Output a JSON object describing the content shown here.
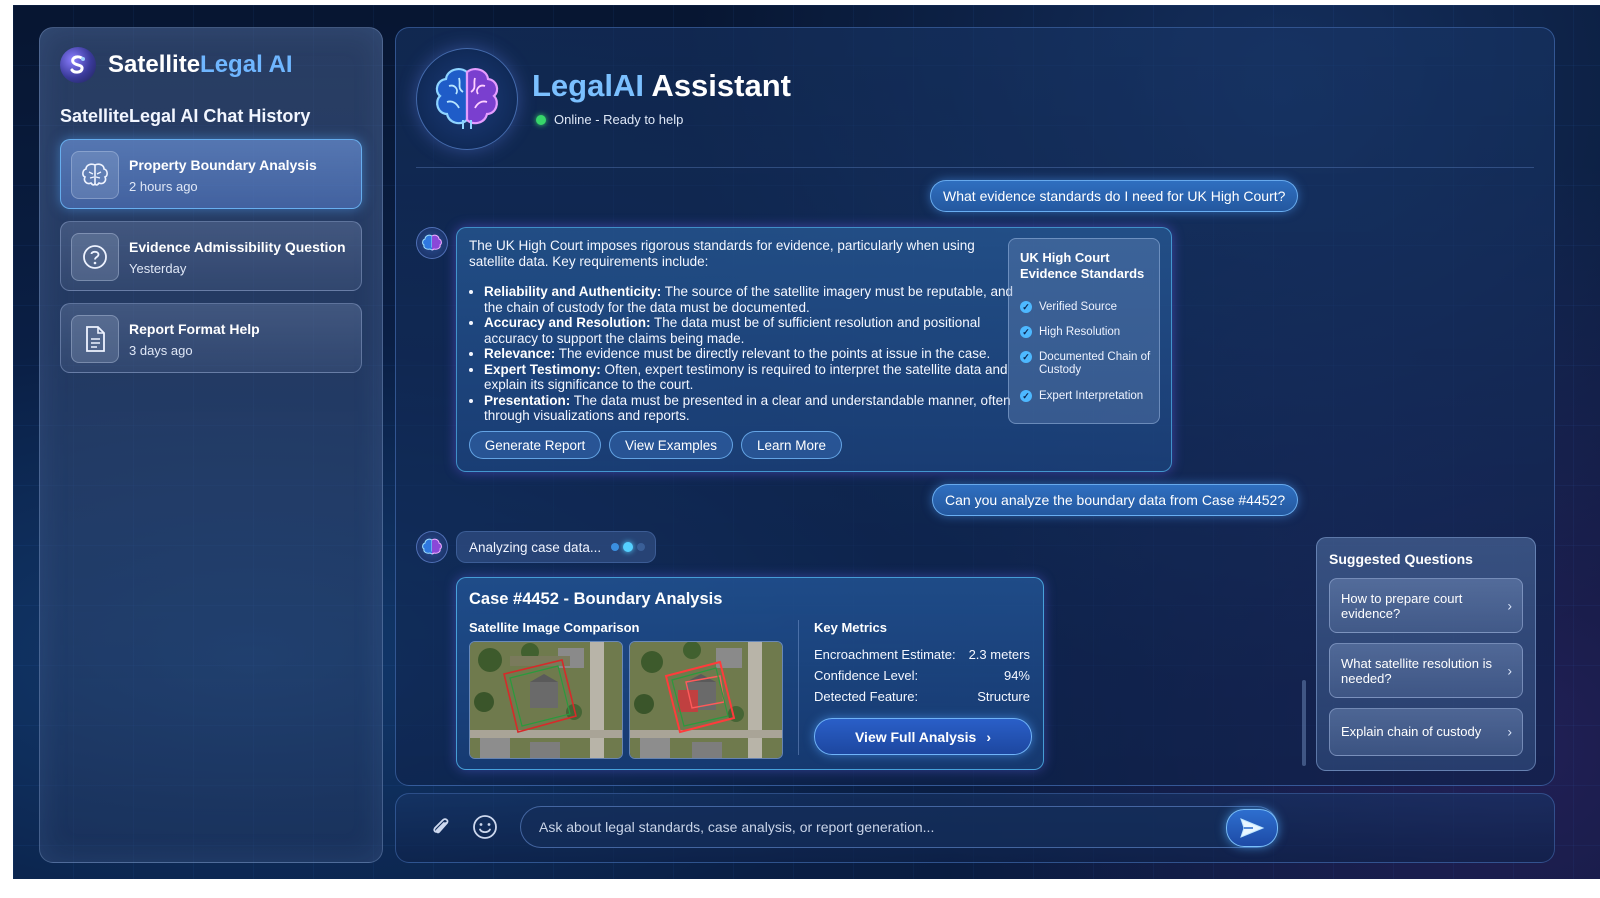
{
  "brand": {
    "name_part1": "Satellite",
    "name_part2": "Legal AI",
    "logo_glyph": "S"
  },
  "sidebar": {
    "title": "SatelliteLegal AI Chat History",
    "items": [
      {
        "title": "Property Boundary Analysis",
        "time": "2 hours ago",
        "icon": "brain-icon",
        "active": true
      },
      {
        "title": "Evidence Admissibility Question",
        "time": "Yesterday",
        "icon": "question-icon",
        "active": false
      },
      {
        "title": "Report Format Help",
        "time": "3 days ago",
        "icon": "document-icon",
        "active": false
      }
    ]
  },
  "assistant": {
    "title_part1": "LegalAI",
    "title_part2": " Assistant",
    "status": "Online - Ready to help",
    "status_color": "#37d66a"
  },
  "conversation": {
    "user_msg_1": "What evidence standards do I need for UK High Court?",
    "bot_intro": "The UK High Court imposes rigorous standards for evidence, particularly when using satellite data. Key requirements include:",
    "requirements": [
      {
        "term": "Reliability and Authenticity:",
        "text": " The source of the satellite imagery must be reputable, and the chain of custody for the data must be documented."
      },
      {
        "term": "Accuracy and Resolution:",
        "text": " The data must be of sufficient resolution and positional accuracy to support the claims being made."
      },
      {
        "term": "Relevance:",
        "text": " The evidence must be directly relevant to the points at issue in the case."
      },
      {
        "term": "Expert Testimony:",
        "text": " Often, expert testimony is required to interpret the satellite data and explain its significance to the court."
      },
      {
        "term": "Presentation:",
        "text": " The data must be presented in a clear and understandable manner, often through visualizations and reports."
      }
    ],
    "standards_box": {
      "title": "UK High Court Evidence Standards",
      "items": [
        "Verified Source",
        "High Resolution",
        "Documented Chain of Custody",
        "Expert Interpretation"
      ]
    },
    "actions": [
      "Generate Report",
      "View Examples",
      "Learn More"
    ],
    "user_msg_2": "Can you analyze the boundary data from Case #4452?",
    "analyzing": "Analyzing case data...",
    "case": {
      "title": "Case #4452 - Boundary Analysis",
      "image_label": "Satellite Image Comparison",
      "metrics_label": "Key Metrics",
      "metrics": [
        {
          "label": "Encroachment Estimate:",
          "value": "2.3 meters"
        },
        {
          "label": "Confidence Level:",
          "value": "94%"
        },
        {
          "label": "Detected Feature:",
          "value": "Structure"
        }
      ],
      "button": "View Full Analysis"
    }
  },
  "suggestions": {
    "title": "Suggested Questions",
    "items": [
      "How to prepare court evidence?",
      "What satellite resolution is needed?",
      "Explain chain of custody"
    ]
  },
  "input": {
    "placeholder": "Ask about legal standards, case analysis, or report generation..."
  },
  "colors": {
    "accent": "#6fb6ff",
    "send": "#2e6fcf",
    "online": "#37d66a"
  }
}
